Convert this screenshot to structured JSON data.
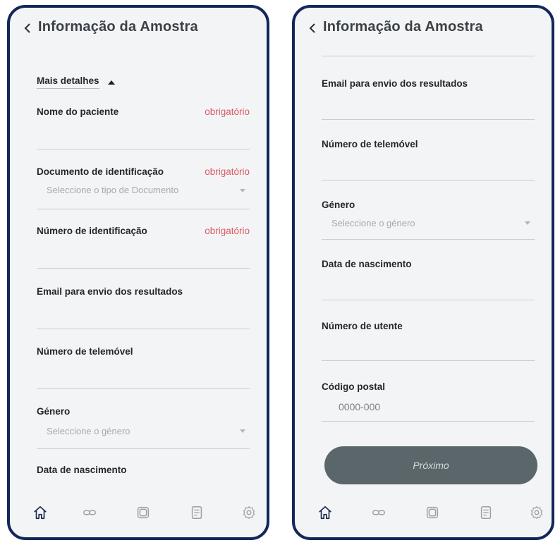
{
  "screen_left": {
    "header": {
      "title": "Informação da Amostra"
    },
    "more_details": {
      "label": "Mais detalhes"
    },
    "fields": {
      "patient_name": {
        "label": "Nome do paciente",
        "required": "obrigatório"
      },
      "id_document": {
        "label": "Documento de identificação",
        "required": "obrigatório",
        "placeholder": "Seleccione o tipo de Documento"
      },
      "id_number": {
        "label": "Número de identificação",
        "required": "obrigatório"
      },
      "email": {
        "label": "Email para envio dos resultados"
      },
      "phone": {
        "label": "Número de telemóvel"
      },
      "gender": {
        "label": "Género",
        "placeholder": "Seleccione o género"
      },
      "birth_date": {
        "label": "Data de nascimento"
      }
    }
  },
  "screen_right": {
    "header": {
      "title": "Informação da Amostra"
    },
    "fields": {
      "email": {
        "label": "Email para envio dos resultados"
      },
      "phone": {
        "label": "Número de telemóvel"
      },
      "gender": {
        "label": "Género",
        "placeholder": "Seleccione o género"
      },
      "birth_date": {
        "label": "Data de nascimento"
      },
      "health_number": {
        "label": "Número de utente"
      },
      "postal_code": {
        "label": "Código postal",
        "placeholder": "0000-000"
      }
    },
    "next_button": {
      "label": "Próximo"
    }
  },
  "tabbar": {
    "icons": [
      "home-icon",
      "link-icon",
      "layers-icon",
      "document-icon",
      "settings-icon"
    ],
    "active_color": "#1e2a4f",
    "inactive_color": "#9aa0a6"
  },
  "colors": {
    "frame": "#14275a",
    "required": "#d95b63",
    "button": "#5a6669",
    "background": "#f3f4f6"
  }
}
